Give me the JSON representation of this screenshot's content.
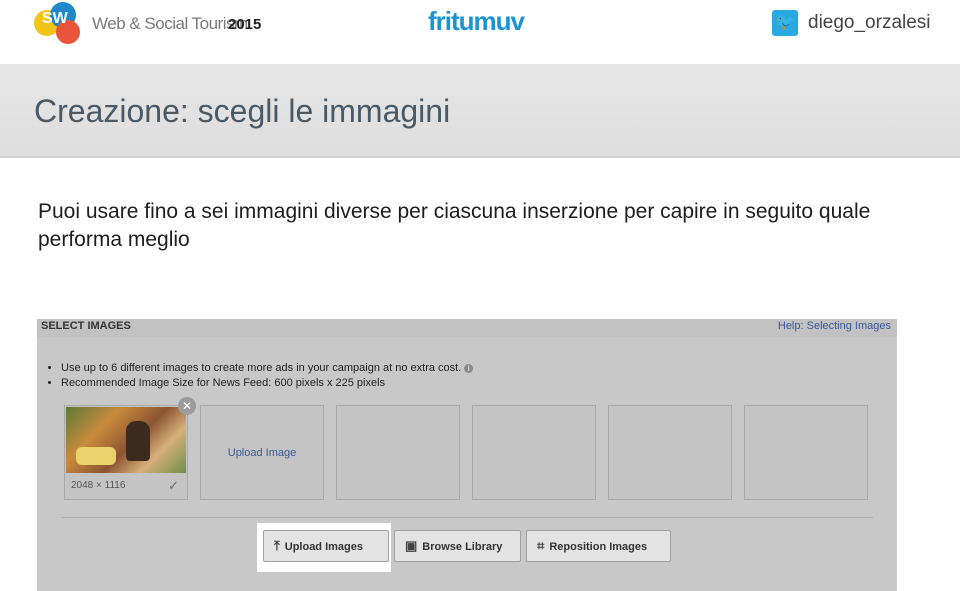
{
  "header": {
    "logo_text": "SW",
    "conference_title": "Web & Social Tourism",
    "conference_year": "2015",
    "center_logo": "fritumuv",
    "twitter_icon": "twitter-bird-icon",
    "twitter_handle": "diego_orzalesi"
  },
  "slide": {
    "title": "Creazione: scegli le immagini",
    "body": "Puoi usare fino a sei immagini diverse per ciascuna inserzione per capire in seguito quale performa meglio"
  },
  "screenshot": {
    "section_title": "SELECT IMAGES",
    "help_link": "Help: Selecting Images",
    "bullets": [
      "Use up to 6 different images to create more ads in your campaign at no extra cost.",
      "Recommended Image Size for News Feed: 600 pixels x 225 pixels"
    ],
    "selected_image_size": "2048 × 1116",
    "upload_tile_label": "Upload Image",
    "buttons": {
      "upload": "Upload Images",
      "browse": "Browse Library",
      "reposition": "Reposition Images"
    }
  }
}
